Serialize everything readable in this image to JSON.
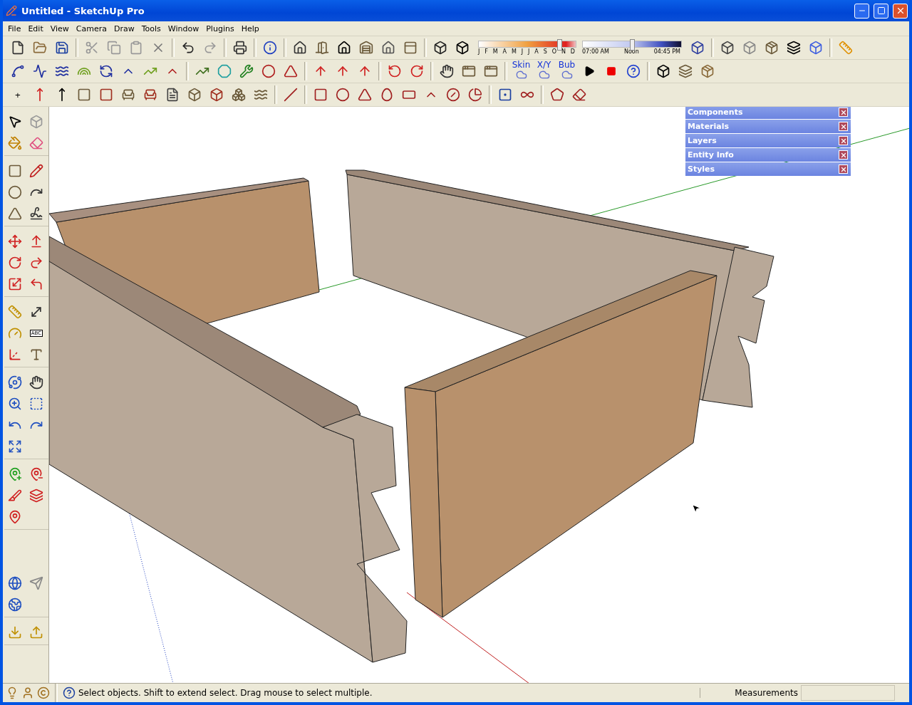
{
  "window": {
    "title": "Untitled - SketchUp Pro"
  },
  "menu": [
    "File",
    "Edit",
    "View",
    "Camera",
    "Draw",
    "Tools",
    "Window",
    "Plugins",
    "Help"
  ],
  "shadow_settings": {
    "months": [
      "J",
      "F",
      "M",
      "A",
      "M",
      "J",
      "J",
      "A",
      "S",
      "O",
      "N",
      "D"
    ],
    "month_slider": {
      "level": 0.83
    },
    "times": [
      "07:00 AM",
      "Noon",
      "04:45 PM"
    ],
    "time_slider": {
      "level": 0.5
    }
  },
  "plugin_buttons": [
    "Skin",
    "X/Y",
    "Bub"
  ],
  "axes_button": "+",
  "text_tool_label": "ABC",
  "tray_panels": [
    {
      "title": "Components"
    },
    {
      "title": "Materials"
    },
    {
      "title": "Layers"
    },
    {
      "title": "Entity Info"
    },
    {
      "title": "Styles"
    }
  ],
  "status_bar": {
    "hint": "Select objects. Shift to extend select. Drag mouse to select multiple.",
    "measurements_label": "Measurements"
  }
}
